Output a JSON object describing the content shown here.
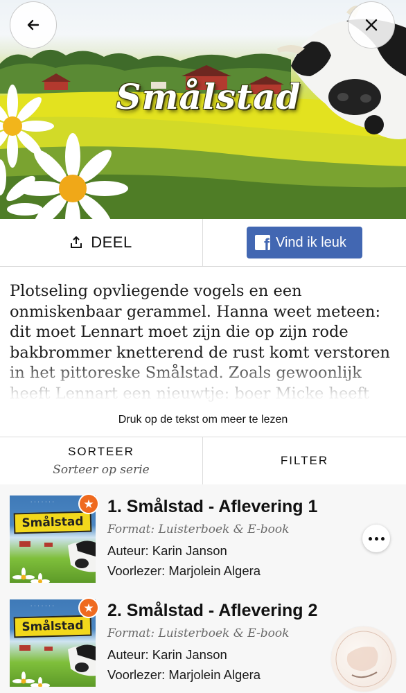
{
  "header": {
    "title": "Smålstad",
    "back_icon": "arrow-left-icon",
    "close_icon": "close-icon"
  },
  "actions": {
    "share_label": "DEEL",
    "share_icon": "share-upload-icon",
    "like_label": "Vind ik leuk",
    "like_icon": "facebook-icon",
    "facebook_color": "#4267b2"
  },
  "description": {
    "text": "Plotseling opvliegende vogels en een onmiskenbaar gerammel. Hanna weet meteen: dit moet Lennart moet zijn die op zijn rode bakbrommer knetterend de rust komt verstoren in het pittoreske Smålstad. Zoals gewoonlijk heeft Lennart een nieuwtje: boer Micke heeft",
    "read_more": "Druk op de tekst om meer te lezen"
  },
  "controls": {
    "sort_label": "SORTEER",
    "sort_value": "Sorteer op serie",
    "filter_label": "FILTER"
  },
  "episodes": [
    {
      "title": "1. Smålstad - Aflevering 1",
      "format": "Format: Luisterboek & E-book",
      "author": "Auteur: Karin Janson",
      "reader": "Voorlezer: Marjolein Algera",
      "cover_title": "Smålstad",
      "badge_icon": "star-icon",
      "badge_color": "#ef6a1f"
    },
    {
      "title": "2. Smålstad - Aflevering 2",
      "format": "Format: Luisterboek & E-book",
      "author": "Auteur: Karin Janson",
      "reader": "Voorlezer: Marjolein Algera",
      "cover_title": "Smålstad",
      "badge_icon": "star-icon",
      "badge_color": "#ef6a1f"
    }
  ]
}
